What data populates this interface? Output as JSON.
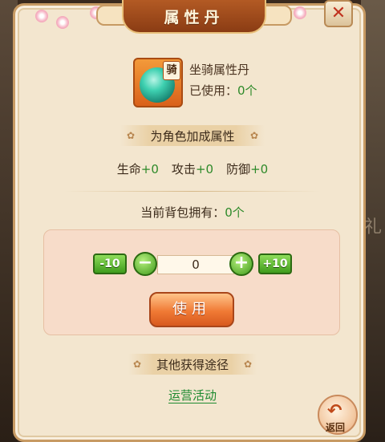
{
  "title": "属性丹",
  "item": {
    "name": "坐骑属性丹",
    "badge": "骑",
    "used_label": "已使用：",
    "used_value": "0个"
  },
  "attribute_section": {
    "header": "为角色加成属性",
    "stats": [
      {
        "label": "生命",
        "value": "+0"
      },
      {
        "label": "攻击",
        "value": "+0"
      },
      {
        "label": "防御",
        "value": "+0"
      }
    ]
  },
  "bag": {
    "label": "当前背包拥有：",
    "value": "0个"
  },
  "quantity": {
    "minus10_label": "-10",
    "minus_label": "−",
    "value": "0",
    "plus_label": "+",
    "plus10_label": "+10"
  },
  "use_button": "使用",
  "other_sources": {
    "header": "其他获得途径",
    "link": "运营活动"
  },
  "return_button": "返回",
  "background_glyph": "礼",
  "colors": {
    "panel_bg": "#f3e6cf",
    "title_ribbon": "#b35a24",
    "green_value": "#2e8a2a",
    "use_button": "#f07a35",
    "link": "#1e8a30",
    "close_x": "#c0321f"
  }
}
